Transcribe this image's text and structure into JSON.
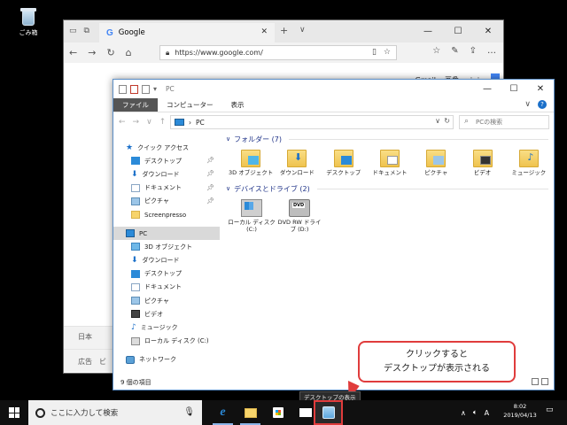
{
  "desktop": {
    "recycle_bin_label": "ごみ箱"
  },
  "browser": {
    "tab_title": "Google",
    "tab_logo": "G",
    "address": "https://www.google.com/",
    "top_links": [
      "Gmail",
      "画像"
    ],
    "footer_country": "日本",
    "footer_links": [
      "広告",
      "ビ"
    ]
  },
  "explorer": {
    "title": "PC",
    "ribbon_tabs": [
      "ファイル",
      "コンピューター",
      "表示"
    ],
    "path_label": "PC",
    "search_placeholder": "PCの検索",
    "nav": {
      "quick_access": "クイック アクセス",
      "quick_items": [
        "デスクトップ",
        "ダウンロード",
        "ドキュメント",
        "ピクチャ",
        "Screenpresso"
      ],
      "pc": "PC",
      "pc_items": [
        "3D オブジェクト",
        "ダウンロード",
        "デスクトップ",
        "ドキュメント",
        "ピクチャ",
        "ビデオ",
        "ミュージック",
        "ローカル ディスク (C:)"
      ],
      "network": "ネットワーク"
    },
    "groups": {
      "folders_header": "フォルダー (7)",
      "folders": [
        "3D オブジェクト",
        "ダウンロード",
        "デスクトップ",
        "ドキュメント",
        "ピクチャ",
        "ビデオ",
        "ミュージック"
      ],
      "drives_header": "デバイスとドライブ (2)",
      "drives": [
        "ローカル ディスク (C:)",
        "DVD RW ドライブ (D:)"
      ],
      "dvd_badge": "DVD"
    },
    "status_text": "9 個の項目"
  },
  "callout": {
    "line1": "クリックすると",
    "line2": "デスクトップが表示される"
  },
  "tooltip": "デスクトップの表示",
  "taskbar": {
    "search_placeholder": "ここに入力して検索",
    "ime_label": "A",
    "time": "8:02",
    "date": "2019/04/13"
  },
  "colors": {
    "highlight_red": "#e03c3c",
    "accent_blue": "#1a6fc9",
    "folder_yellow": "#f7d46b"
  }
}
